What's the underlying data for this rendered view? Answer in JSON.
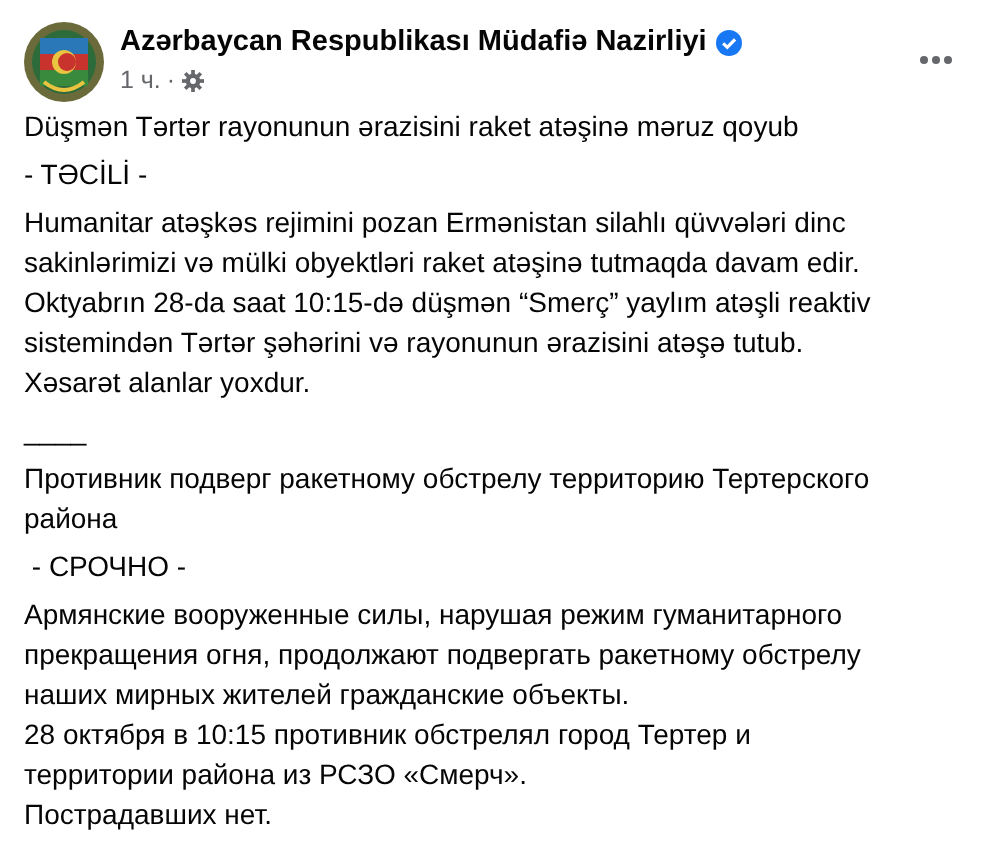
{
  "post": {
    "author": "Azərbaycan Respublikası Müdafiə Nazirliyi",
    "verified": true,
    "time": "1 ч.",
    "separator": "·",
    "paragraphs": [
      {
        "lines": [
          "Düşmən Tərtər rayonunun ərazisini raket atəşinə məruz qoyub"
        ]
      },
      {
        "lines": [
          "- TƏCİLİ -"
        ]
      },
      {
        "lines": [
          "Humanitar atəşkəs rejimini pozan Ermənistan silahlı qüvvələri dinc",
          "sakinlərimizi və mülki obyektləri raket atəşinə tutmaqda davam edir.",
          "Oktyabrın 28-da saat 10:15-də düşmən “Smerç” yaylım atəşli reaktiv",
          "sistemindən Tərtər şəhərini və rayonunun ərazisini atəşə tutub.",
          "Xəsarət alanlar yoxdur."
        ]
      },
      {
        "lines": [
          "____"
        ]
      },
      {
        "lines": [
          "Противник подверг ракетному обстрелу территорию Тертерского",
          "района"
        ]
      },
      {
        "lines": [
          " - СРОЧНО -"
        ]
      },
      {
        "lines": [
          "Армянские вооруженные силы, нарушая режим гуманитарного",
          "прекращения огня, продолжают подвергать ракетному обстрелу",
          "наших мирных жителей гражданские объекты.",
          "28 октября в 10:15 противник обстрелял город Тертер и",
          "территории района из РСЗО «Смерч».",
          "Пострадавших нет."
        ]
      }
    ]
  }
}
